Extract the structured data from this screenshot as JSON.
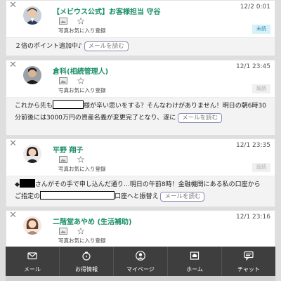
{
  "messages": [
    {
      "sender": "【メビウス公式】お客様担当 守谷",
      "time": "12/2 0:01",
      "photo_label": "写真",
      "fav_label": "お気に入り登録",
      "badge": "未読",
      "body_1": "２倍のポイント追加中♪",
      "read_more": "メールを読む"
    },
    {
      "sender": "倉科(相続管理人)",
      "time": "12/1 23:45",
      "photo_label": "写真",
      "fav_label": "お気に入り登録",
      "badge": "既読",
      "body_1": "これから先も",
      "body_2": "様が辛い思いをする？そんなわけがありません！明日の朝6時30分前後には3000万円の資産名義が変更完了となり、遂に",
      "read_more": "メールを読む"
    },
    {
      "sender": "平野 翔子",
      "time": "12/1 23:35",
      "photo_label": "写真",
      "fav_label": "お気に入り登録",
      "badge": "既読",
      "body_1": "◆",
      "body_2": "さんがその手で申し込んだ通り…明日の午前8時！金融機関にある私の口座からご指定の",
      "body_3": "口座へと振替え",
      "read_more": "メールを読む"
    },
    {
      "sender": "二階堂あやめ (生活補助)",
      "time": "12/1 23:16",
      "photo_label": "写真",
      "fav_label": "お気に入り登録"
    }
  ],
  "tabs": [
    {
      "label": "メール",
      "icon": "mail-icon"
    },
    {
      "label": "お得情報",
      "icon": "piggy-bank-icon"
    },
    {
      "label": "マイページ",
      "icon": "user-icon"
    },
    {
      "label": "ホーム",
      "icon": "home-icon"
    },
    {
      "label": "チャット",
      "icon": "chat-icon"
    }
  ],
  "colors": {
    "sender_name": "#1c8f6a",
    "tabbar_bg": "#3e3e3e",
    "unread_badge_bg": "#d8f1f8",
    "unread_badge_text": "#2a8fb5"
  }
}
